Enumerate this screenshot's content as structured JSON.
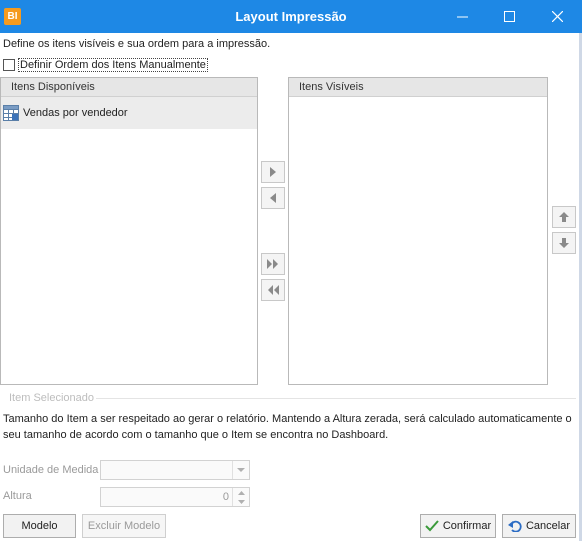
{
  "window": {
    "title": "Layout Impressão",
    "app_badge": "BI",
    "icons": [
      "minimize-icon",
      "maximize-icon",
      "close-icon"
    ]
  },
  "description": "Define os itens visíveis e sua ordem para a impressão.",
  "manual_order": {
    "label": "Definir Ordem dos Itens Manualmente",
    "checked": false
  },
  "available": {
    "header": "Itens Disponíveis",
    "items": [
      {
        "label": "Vendas por vendedor",
        "icon": "table-report-icon"
      }
    ]
  },
  "visible": {
    "header": "Itens Visíveis",
    "items": []
  },
  "transfer_buttons": [
    "move-right-icon",
    "move-left-icon",
    "move-all-right-icon",
    "move-all-left-icon"
  ],
  "order_buttons": [
    "move-up-icon",
    "move-down-icon"
  ],
  "selected_item": {
    "group_title": "Item Selecionado",
    "info": "Tamanho do Item a ser respeitado ao gerar o relatório. Mantendo a Altura zerada, será calculado automaticamente o seu tamanho de acordo com o tamanho que o Item se encontra no Dashboard.",
    "unit_label": "Unidade de Medida",
    "unit_value": "",
    "height_label": "Altura",
    "height_value": "0"
  },
  "footer": {
    "model_label": "Modelo",
    "delete_model_label": "Excluir Modelo",
    "confirm_label": "Confirmar",
    "cancel_label": "Cancelar"
  },
  "colors": {
    "titlebar": "#1e88e5",
    "app_badge": "#f59b1f",
    "confirm_icon": "#3a9a3a",
    "cancel_icon": "#2b6cc4"
  }
}
